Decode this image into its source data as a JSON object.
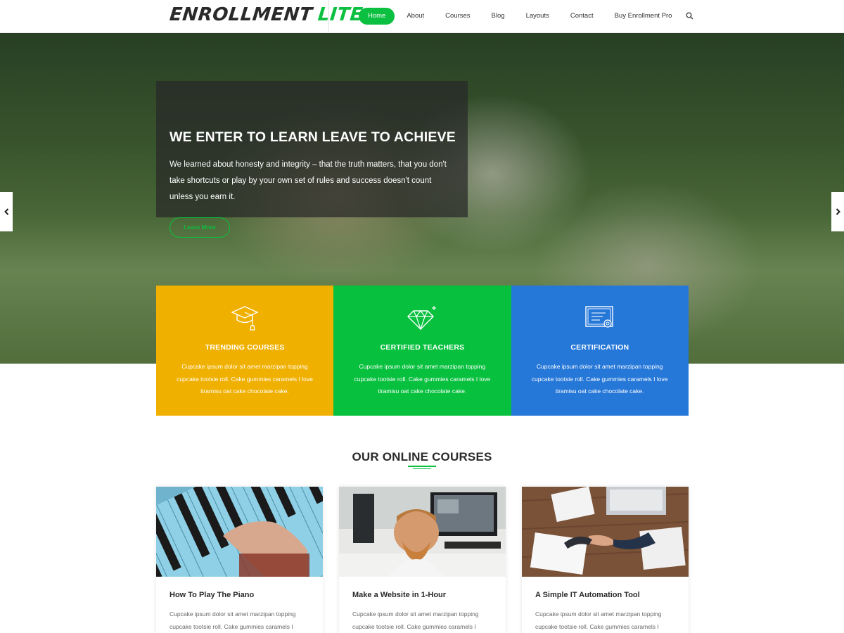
{
  "header": {
    "logo_part1": "ENROLLMENT",
    "logo_part2": "LITE",
    "nav": [
      {
        "label": "Home",
        "active": true
      },
      {
        "label": "About"
      },
      {
        "label": "Courses"
      },
      {
        "label": "Blog"
      },
      {
        "label": "Layouts"
      },
      {
        "label": "Contact"
      },
      {
        "label": "Buy Enrollment Pro"
      }
    ],
    "search_icon": "search-icon"
  },
  "hero": {
    "title": "WE ENTER TO LEARN LEAVE TO ACHIEVE",
    "text": "We learned about honesty and integrity – that the truth matters, that you don't take shortcuts or play by your own set of rules and success doesn't count unless you earn it.",
    "button_label": "Learn More",
    "prev_arrow": "‹",
    "next_arrow": "›"
  },
  "features": [
    {
      "icon": "graduation-cap-icon",
      "title": "TRENDING COURSES",
      "text": "Cupcake ipsum dolor sit amet marzipan topping cupcake tootsie roll. Cake gummies caramels I love tiramisu oat cake chocolate cake.",
      "color": "#f0b000"
    },
    {
      "icon": "diamond-icon",
      "title": "CERTIFIED TEACHERS",
      "text": "Cupcake ipsum dolor sit amet marzipan topping cupcake tootsie roll. Cake gummies caramels I love tiramisu oat cake chocolate cake.",
      "color": "#07c03e"
    },
    {
      "icon": "certificate-icon",
      "title": "CERTIFICATION",
      "text": "Cupcake ipsum dolor sit amet marzipan topping cupcake tootsie roll. Cake gummies caramels I love tiramisu oat cake chocolate cake.",
      "color": "#2577d8"
    }
  ],
  "courses_section": {
    "title": "OUR ONLINE COURSES",
    "courses": [
      {
        "title": "How To Play The Piano",
        "text": "Cupcake ipsum dolor sit amet marzipan topping cupcake tootsie roll. Cake gummies caramels I"
      },
      {
        "title": "Make a Website in 1-Hour",
        "text": "Cupcake ipsum dolor sit amet marzipan topping cupcake tootsie roll. Cake gummies caramels I"
      },
      {
        "title": "A Simple IT Automation Tool",
        "text": "Cupcake ipsum dolor sit amet marzipan topping cupcake tootsie roll. Cake gummies caramels I"
      }
    ]
  },
  "colors": {
    "accent": "#0bbf40",
    "feature_yellow": "#f0b000",
    "feature_green": "#07c03e",
    "feature_blue": "#2577d8"
  }
}
